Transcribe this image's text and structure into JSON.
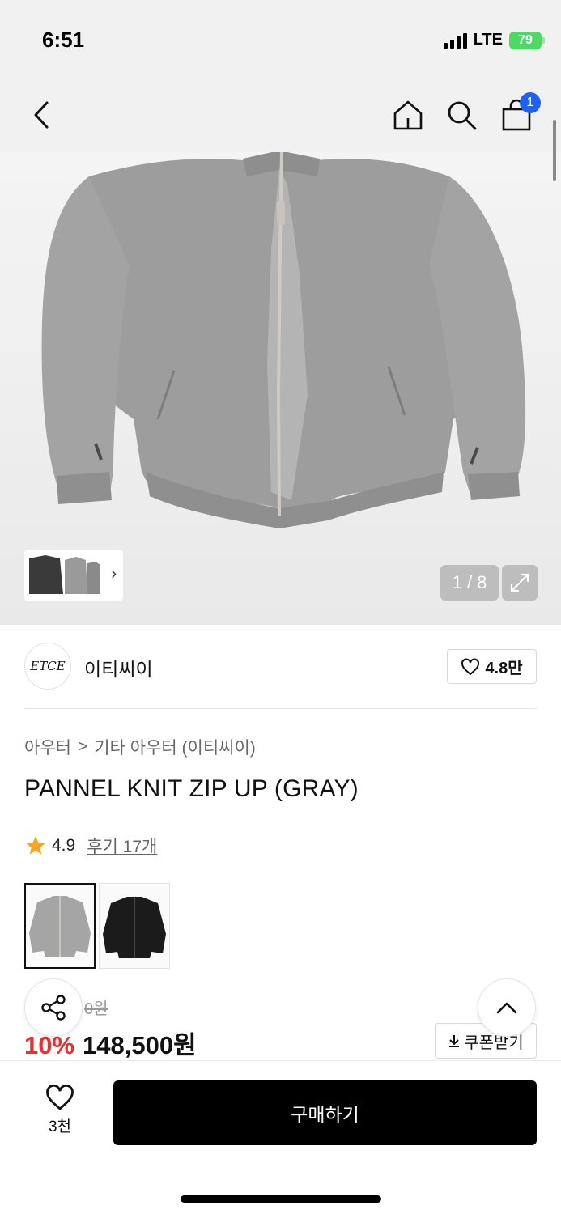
{
  "status": {
    "time": "6:51",
    "network": "LTE",
    "battery": "79"
  },
  "nav": {
    "cart_count": "1"
  },
  "gallery": {
    "counter": "1 / 8"
  },
  "brand": {
    "logo_text": "ETCE",
    "name": "이티씨이",
    "likes": "4.8만"
  },
  "breadcrumb": {
    "category": "아우터",
    "separator": ">",
    "subcategory": "기타 아우터 (이티씨이)"
  },
  "product": {
    "title": "PANNEL KNIT ZIP UP (GRAY)",
    "rating": "4.9",
    "reviews": "후기 17개",
    "original_price": "0원",
    "discount": "10%",
    "price": "148,500원",
    "coupon_label": "쿠폰받기"
  },
  "bottom": {
    "wish_count": "3천",
    "buy_label": "구매하기"
  },
  "colors": {
    "accent": "#1e62f0",
    "discount": "#f02c2c",
    "star": "#f5a623",
    "buy": "#000000"
  },
  "icons": [
    "back-icon",
    "home-icon",
    "search-icon",
    "shopping-bag-icon",
    "expand-icon",
    "heart-icon",
    "star-icon",
    "share-icon",
    "chevron-up-icon",
    "download-icon",
    "chevron-right-icon"
  ]
}
